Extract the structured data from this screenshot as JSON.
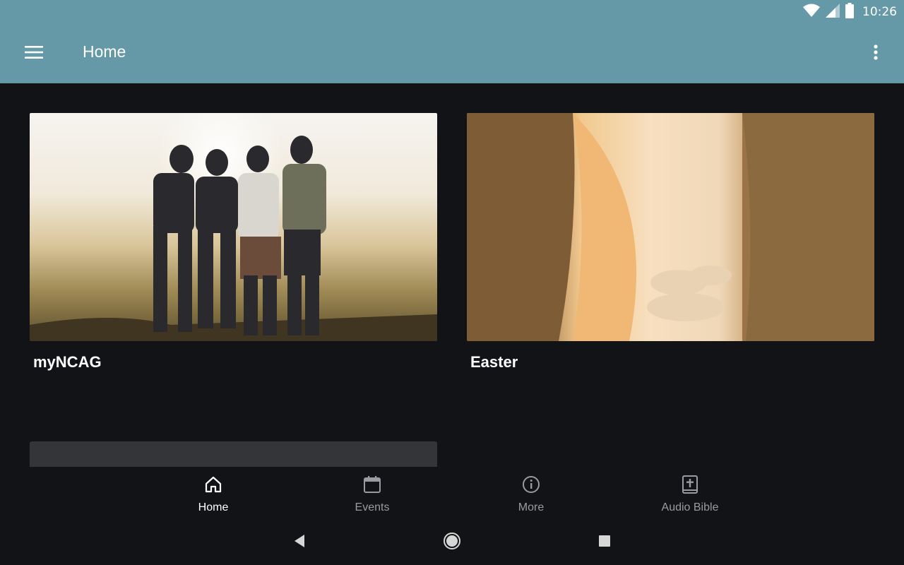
{
  "status_bar": {
    "time": "10:26",
    "icons": [
      "wifi-icon",
      "signal-icon",
      "battery-icon"
    ]
  },
  "app_bar": {
    "title": "Home",
    "icons": [
      "hamburger-menu-icon",
      "overflow-menu-icon"
    ]
  },
  "cards": [
    {
      "title": "myNCAG",
      "image": "friends-at-sunset-photo"
    },
    {
      "title": "Easter",
      "image": "empty-tomb-photo"
    }
  ],
  "bottom_nav": {
    "items": [
      {
        "label": "Home",
        "icon": "home-icon",
        "active": true
      },
      {
        "label": "Events",
        "icon": "calendar-icon",
        "active": false
      },
      {
        "label": "More",
        "icon": "info-icon",
        "active": false
      },
      {
        "label": "Audio Bible",
        "icon": "bible-icon",
        "active": false
      }
    ]
  },
  "system_nav": [
    "back-icon",
    "home-circle-icon",
    "recents-icon"
  ],
  "colors": {
    "app_bar": "#6699a8",
    "background": "#121316",
    "nav_active": "#ffffff",
    "nav_inactive": "#9a9ba0",
    "placeholder_card": "#343538"
  }
}
